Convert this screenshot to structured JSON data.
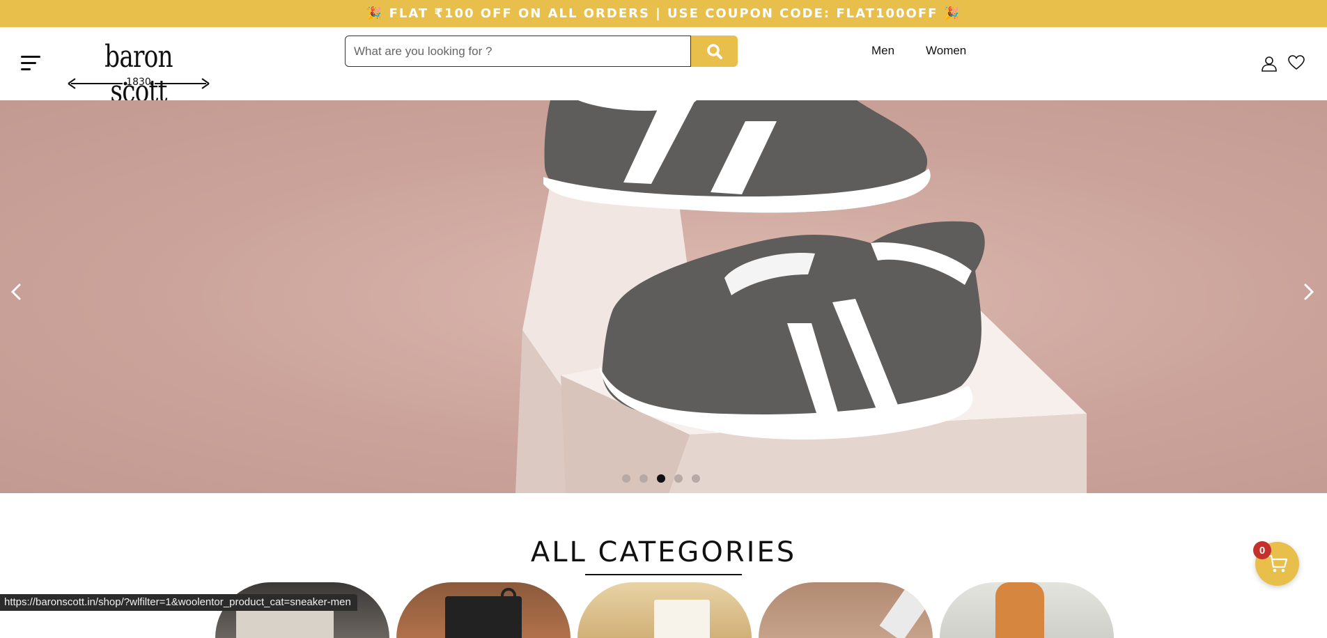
{
  "announcement": {
    "text": "🎉 FLAT ₹100 OFF ON ALL ORDERS | USE COUPON CODE: FLAT100OFF 🎉"
  },
  "header": {
    "logo": {
      "wordmark": "baron scott",
      "year": "1830"
    },
    "search": {
      "placeholder": "What are you looking for ?",
      "value": "",
      "button_icon": "search-icon"
    },
    "nav": [
      {
        "label": "Men"
      },
      {
        "label": "Women"
      }
    ],
    "icons": [
      "menu-icon",
      "user-icon",
      "heart-icon"
    ]
  },
  "hero": {
    "slide_count": 5,
    "active_slide": 3,
    "prev_icon": "chevron-left-icon",
    "next_icon": "chevron-right-icon"
  },
  "categories": {
    "title": "ALL CATEGORIES",
    "items_visible": 5
  },
  "cart": {
    "count": "0",
    "icon": "cart-icon"
  },
  "status_bar": {
    "url": "https://baronscott.in/shop/?wlfilter=1&woolentor_product_cat=sneaker-men"
  },
  "colors": {
    "accent": "#e9bf4c",
    "badge": "#c4302b",
    "hero_bg": "#c9a59c"
  }
}
